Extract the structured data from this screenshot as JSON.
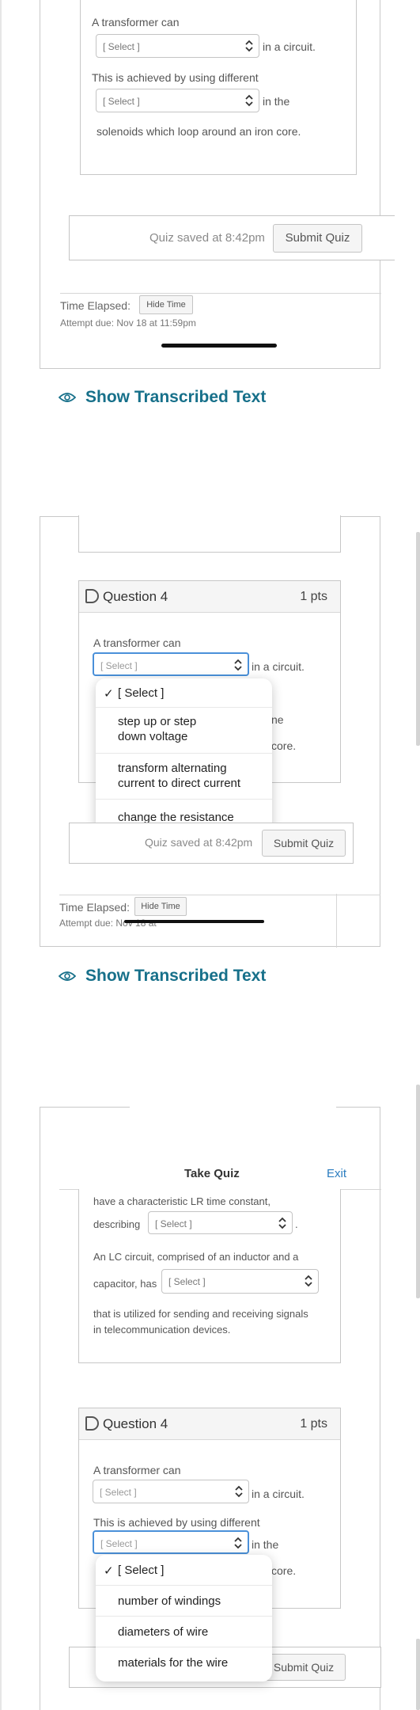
{
  "screens": [
    {
      "question_text": {
        "line1": "A transformer can",
        "after1": "in a circuit.",
        "line2": "This is achieved by using different",
        "after2": "in the",
        "line3": "solenoids which loop around an iron core."
      },
      "select1": "[ Select ]",
      "select2": "[ Select ]",
      "saved": "Quiz saved at 8:42pm",
      "submit": "Submit Quiz",
      "time_label": "Time Elapsed:",
      "hide_time": "Hide Time",
      "due": "Attempt due: Nov 18 at 11:59pm",
      "show_transcribed": "Show Transcribed Text"
    },
    {
      "question_title": "Question 4",
      "points": "1 pts",
      "line1": "A transformer can",
      "select1": "[ Select ]",
      "after1": "in a circuit.",
      "partial_he": "ne",
      "partial_core": "core.",
      "dropdown_options": [
        "[ Select ]",
        "step up or step\ndown voltage",
        "transform alternating\ncurrent to direct current",
        "change the resistance"
      ],
      "saved": "Quiz saved at 8:42pm",
      "submit": "Submit Quiz",
      "time_label": "Time Elapsed:",
      "hide_time": "Hide Time",
      "due": "Attempt due: Nov 18 at",
      "show_transcribed": "Show Transcribed Text"
    },
    {
      "nav_title": "Take Quiz",
      "nav_exit": "Exit",
      "prev_line1": "have a characteristic LR time constant,",
      "prev_describing": "describing",
      "prev_select1": "[ Select ]",
      "prev_period": ".",
      "prev_line2": "An LC circuit, comprised of an inductor and a",
      "prev_capacitor": "capacitor, has",
      "prev_select2": "[ Select ]",
      "prev_line3": "that is utilized for sending and receiving signals",
      "prev_line4": "in telecommunication devices.",
      "question_title": "Question 4",
      "points": "1 pts",
      "line1": "A transformer can",
      "select1": "[ Select ]",
      "after1": "in a circuit.",
      "line2": "This is achieved by using different",
      "select2": "[ Select ]",
      "after2": "in the",
      "partial_core": "core.",
      "dropdown_options": [
        "[ Select ]",
        "number of windings",
        "diameters of wire",
        "materials for the wire"
      ],
      "submit": "Submit Quiz"
    }
  ]
}
